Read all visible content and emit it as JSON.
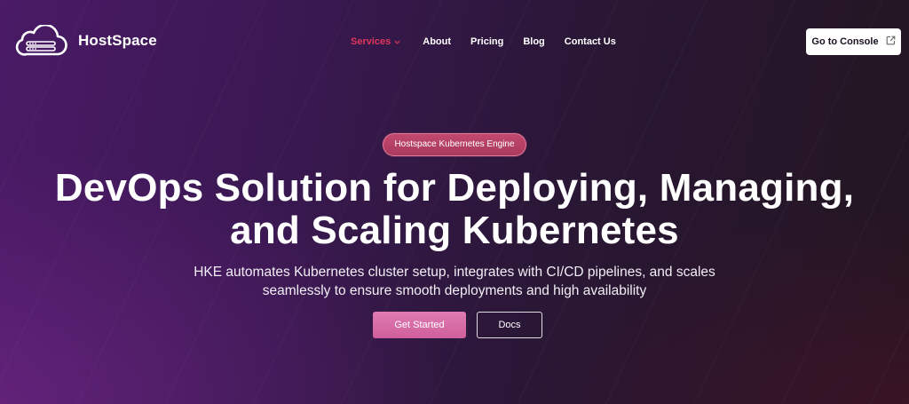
{
  "brand": {
    "name": "HostSpace",
    "logo_icon": "cloud-server-icon"
  },
  "nav": {
    "items": [
      {
        "label": "Services",
        "active": true,
        "has_dropdown": true
      },
      {
        "label": "About"
      },
      {
        "label": "Pricing"
      },
      {
        "label": "Blog"
      },
      {
        "label": "Contact Us"
      }
    ],
    "active_color": "#e0365a"
  },
  "header": {
    "console_button": {
      "label": "Go to Console",
      "icon": "external-link-icon"
    }
  },
  "hero": {
    "badge": "Hostspace Kubernetes Engine",
    "headline_lines": [
      "DevOps Solution for Deploying, Managing,",
      "and Scaling Kubernetes"
    ],
    "subtext_lines": [
      "HKE automates Kubernetes cluster setup, integrates with CI/CD pipelines, and scales",
      "seamlessly to ensure smooth deployments and high availability"
    ],
    "primary_cta": "Get Started",
    "secondary_cta": "Docs"
  },
  "colors": {
    "badge_bg": "#b5426a",
    "primary_button": "#d86aa8",
    "background_left": "#4a1a66",
    "background_right": "#231520"
  }
}
